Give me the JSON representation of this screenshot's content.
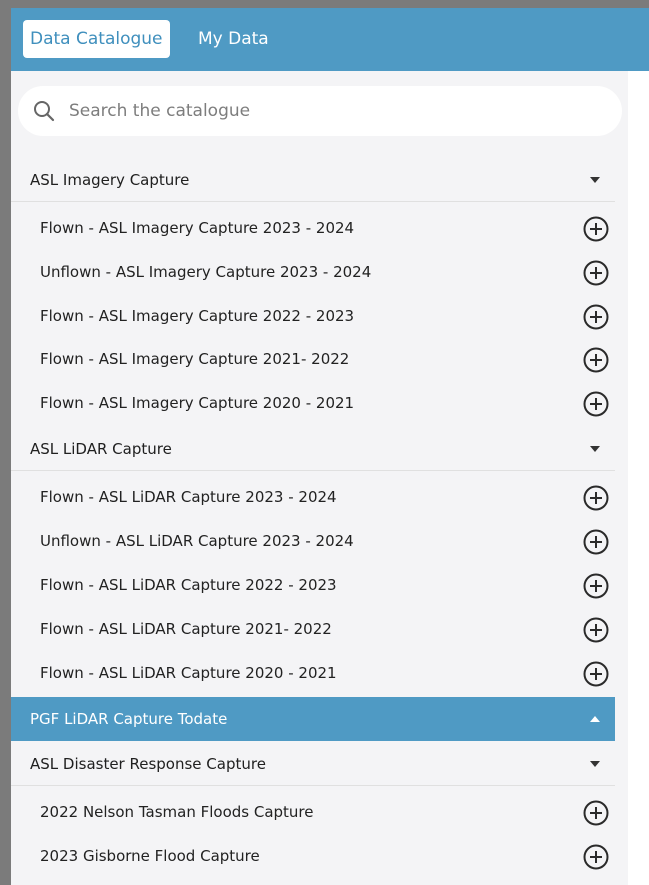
{
  "header": {
    "tabs": [
      {
        "label": "Data Catalogue",
        "active": true
      },
      {
        "label": "My Data",
        "active": false
      }
    ],
    "accent_color": "#4f9ac4"
  },
  "search": {
    "placeholder": "Search the catalogue",
    "icon": "search-icon"
  },
  "catalogue": {
    "groups": [
      {
        "title": "ASL Imagery Capture",
        "state": "expanded",
        "items": [
          {
            "label": "Flown - ASL Imagery Capture 2023 - 2024"
          },
          {
            "label": "Unflown - ASL Imagery Capture 2023 - 2024"
          },
          {
            "label": "Flown - ASL Imagery Capture 2022 - 2023"
          },
          {
            "label": "Flown - ASL Imagery Capture 2021- 2022"
          },
          {
            "label": "Flown - ASL Imagery Capture 2020 - 2021"
          }
        ]
      },
      {
        "title": "ASL LiDAR Capture",
        "state": "expanded",
        "items": [
          {
            "label": "Flown - ASL LiDAR Capture 2023 - 2024"
          },
          {
            "label": "Unflown - ASL LiDAR Capture 2023 - 2024"
          },
          {
            "label": "Flown - ASL LiDAR Capture 2022 - 2023"
          },
          {
            "label": "Flown - ASL LiDAR Capture 2021- 2022"
          },
          {
            "label": "Flown - ASL LiDAR Capture 2020 - 2021"
          }
        ]
      },
      {
        "title": "PGF LiDAR Capture Todate",
        "state": "highlighted",
        "items": []
      },
      {
        "title": "ASL Disaster Response Capture",
        "state": "expanded",
        "items": [
          {
            "label": "2022 Nelson Tasman Floods Capture"
          },
          {
            "label": "2023 Gisborne Flood Capture"
          }
        ]
      }
    ]
  }
}
